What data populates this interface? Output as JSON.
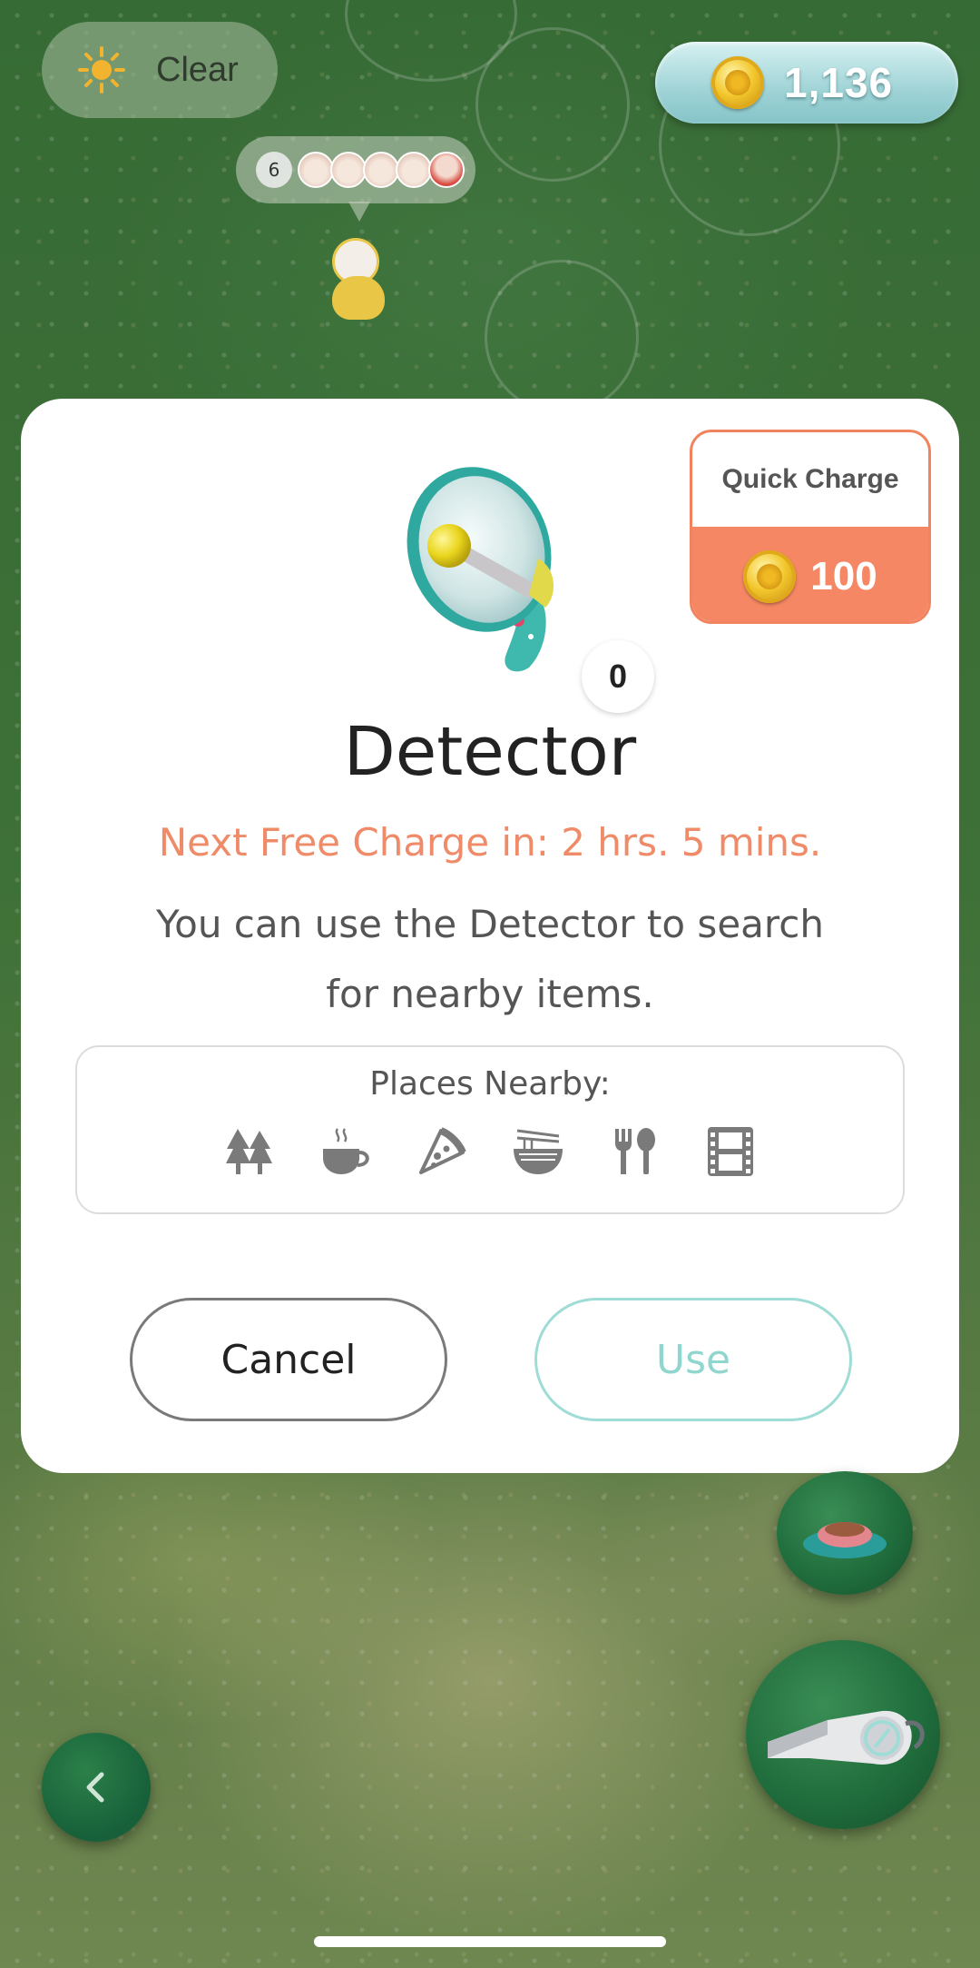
{
  "hud": {
    "weather": {
      "icon": "sun-icon",
      "label": "Clear"
    },
    "coins": {
      "icon": "coin-icon",
      "amount": "1,136"
    },
    "friends": {
      "count": "6"
    }
  },
  "modal": {
    "quick_charge": {
      "label": "Quick Charge",
      "price": "100",
      "icon": "coin-icon"
    },
    "item_icon": "megaphone-detector-icon",
    "item_count": "0",
    "title": "Detector",
    "free_charge_text": "Next Free Charge in: 2 hrs. 5 mins.",
    "description": "You can use the Detector to search for nearby items.",
    "places_label": "Places Nearby:",
    "places_icons": [
      "trees-icon",
      "coffee-cup-icon",
      "pizza-slice-icon",
      "noodle-bowl-icon",
      "fork-spoon-icon",
      "film-strip-icon"
    ],
    "cancel_label": "Cancel",
    "use_label": "Use"
  },
  "colors": {
    "accent_orange": "#f68764",
    "timer_text": "#ef8b68",
    "use_teal": "#9fdcd6",
    "coin_pill": "#9fd3d6"
  },
  "controls": {
    "icons": [
      "pet-bowl-icon",
      "whistle-icon",
      "back-chevron-icon"
    ]
  }
}
